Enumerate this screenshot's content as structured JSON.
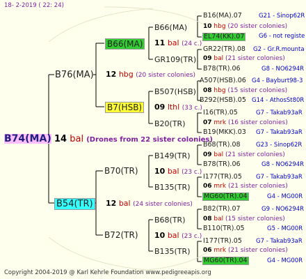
{
  "header": {
    "date": "18-  2-2019 (  22:  24)"
  },
  "footer": {
    "copyright": "Copyright 2004-2019 @ Karl Kehrle Foundation   www.pedigreeapis.org"
  },
  "colors": {
    "background": "#FFFFEE",
    "main_highlight": "#FFBFFF",
    "green_highlight": "#33CC33",
    "yellow_highlight": "#FFFF33",
    "cyan_highlight": "#33FFFF",
    "location": "#0000CC",
    "line": "#000000"
  },
  "root": {
    "name": "B74(MA)",
    "number": "14",
    "code": "bal",
    "note": "(Drones from 22 sister colonies)"
  },
  "gen1": {
    "top": {
      "name": "B76(MA)",
      "number": "12",
      "code": "hbg",
      "note": "(20 sister colonies)"
    },
    "bottom": {
      "name": "B54(TR)",
      "number": "12",
      "code": "bal",
      "note": "(24 sister colonies)"
    }
  },
  "gen2": [
    {
      "name": "B66(MA)",
      "number": "11",
      "code": "bal",
      "note": "(24 c.)"
    },
    {
      "name": "B7(HSB)",
      "number": "09",
      "code": "lthl",
      "note": "(33 c.)"
    },
    {
      "name": "B70(TR)",
      "number": "10",
      "code": "bal",
      "note": "(23 c.)"
    },
    {
      "name": "B72(TR)",
      "number": "10",
      "code": "bal",
      "note": "(23 c.)"
    }
  ],
  "gen3": [
    {
      "name": "B66(MA)",
      "number": "10",
      "code": "hbg",
      "note": "(20 sister colonies)"
    },
    {
      "name": "GR109(TR)",
      "number": "09",
      "code": "bal",
      "note": "(21 sister colonies)"
    },
    {
      "name": "B507(HSB)",
      "number": "08",
      "code": "hbg",
      "note": "(15 sister colonies)"
    },
    {
      "name": "B20(TR)",
      "number": "07",
      "code": "mrk",
      "note": "(16 sister colonies)"
    },
    {
      "name": "B149(TR)",
      "number": "09",
      "code": "bal",
      "note": "(21 sister colonies)"
    },
    {
      "name": "B135(TR)",
      "number": "06",
      "code": "mrk",
      "note": "(21 sister colonies)"
    },
    {
      "name": "B68(TR)",
      "number": "08",
      "code": "bal",
      "note": "(15 sister colonies)"
    },
    {
      "name": "B135(TR)",
      "number": "06",
      "code": "mrk",
      "note": "(21 sister colonies)"
    }
  ],
  "gen4": [
    {
      "name": "B16(MA).07",
      "loc": "G21 - Sinop62R"
    },
    {
      "name": "EL74(KK).07",
      "loc": "G6 - not registe"
    },
    {
      "name": "GR22(TR).08",
      "loc": "G2 - Gr.R.mounta"
    },
    {
      "name": "B78(TR).06",
      "loc": "G8 - NO6294R"
    },
    {
      "name": "A507(HSB).06",
      "loc": "G4 - Bayburt98-3"
    },
    {
      "name": "B292(HSB).05",
      "loc": "G14 - AthosSt80R"
    },
    {
      "name": "I16(TR).05",
      "loc": "G7 - Takab93aR"
    },
    {
      "name": "B19(MKK).03",
      "loc": "G7 - Takab93aR"
    },
    {
      "name": "B68(TR).08",
      "loc": "G23 - Sinop62R"
    },
    {
      "name": "B78(TR).06",
      "loc": "G8 - NO6294R"
    },
    {
      "name": "I177(TR).05",
      "loc": "G7 - Takab93aR"
    },
    {
      "name": "MG60(TR).04",
      "loc": "G4 - MG00R"
    },
    {
      "name": "B82(TR).07",
      "loc": "G9 - NO6294R"
    },
    {
      "name": "B110(TR).05",
      "loc": "G5 - MG00R"
    },
    {
      "name": "I177(TR).05",
      "loc": "G7 - Takab93aR"
    },
    {
      "name": "MG60(TR).04",
      "loc": "G4 - MG00R"
    }
  ]
}
